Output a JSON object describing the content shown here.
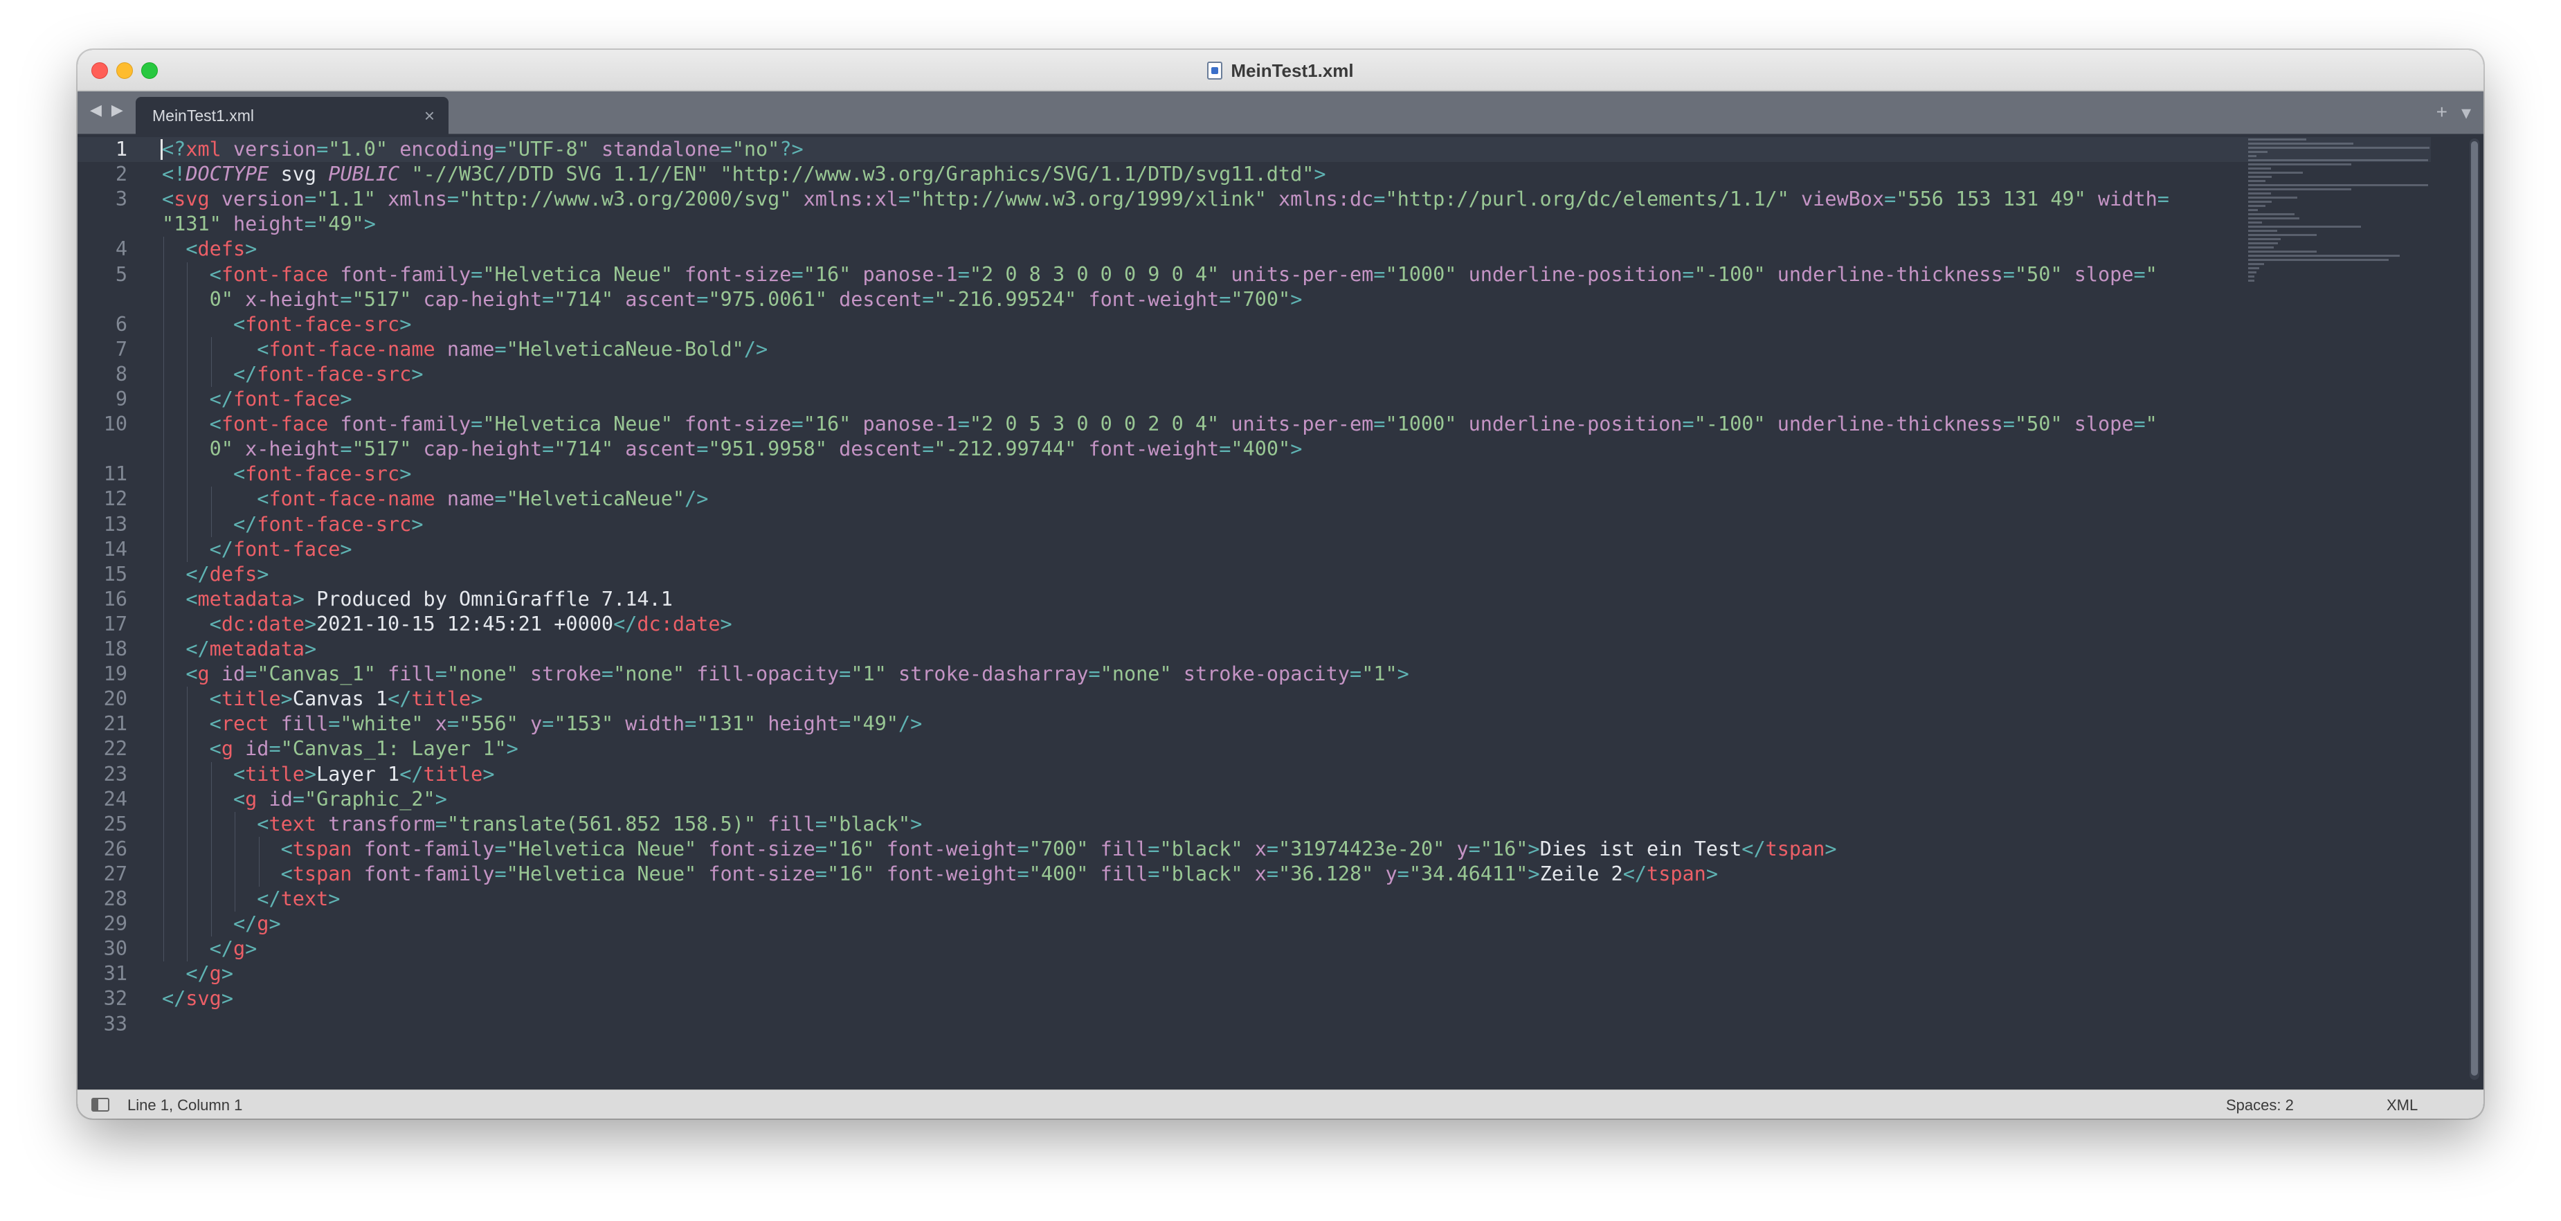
{
  "window": {
    "title": "MeinTest1.xml",
    "icon": "xml-file-icon"
  },
  "tabs": [
    {
      "label": "MeinTest1.xml",
      "close": "×"
    }
  ],
  "nav": {
    "back": "◀",
    "forward": "▶"
  },
  "tab_actions": {
    "new_tab": "+",
    "tab_menu": "▾"
  },
  "status": {
    "position": "Line 1, Column 1",
    "indent": "Spaces: 2",
    "syntax": "XML"
  },
  "editor": {
    "current_line": 1,
    "line_numbers": [
      "1",
      "2",
      "3",
      "4",
      "5",
      "6",
      "7",
      "8",
      "9",
      "10",
      "11",
      "12",
      "13",
      "14",
      "15",
      "16",
      "17",
      "18",
      "19",
      "20",
      "21",
      "22",
      "23",
      "24",
      "25",
      "26",
      "27",
      "28",
      "29",
      "30",
      "31",
      "32",
      "33"
    ]
  },
  "code_lines": [
    [
      [
        "p",
        "<?"
      ],
      [
        "tg",
        "xml"
      ],
      [
        "at",
        " version"
      ],
      [
        "p",
        "="
      ],
      [
        "st",
        "\"1.0\""
      ],
      [
        "at",
        " encoding"
      ],
      [
        "p",
        "="
      ],
      [
        "st",
        "\"UTF-8\""
      ],
      [
        "at",
        " standalone"
      ],
      [
        "p",
        "="
      ],
      [
        "st",
        "\"no\""
      ],
      [
        "p",
        "?>"
      ]
    ],
    [
      [
        "p",
        "<!"
      ],
      [
        "it",
        "DOCTYPE"
      ],
      [
        "tx",
        " svg "
      ],
      [
        "it",
        "PUBLIC"
      ],
      [
        "st",
        " \"-//W3C//DTD SVG 1.1//EN\""
      ],
      [
        "st",
        " \"http://www.w3.org/Graphics/SVG/1.1/DTD/svg11.dtd\""
      ],
      [
        "p",
        ">"
      ]
    ],
    [
      [
        "p",
        "<"
      ],
      [
        "tg",
        "svg"
      ],
      [
        "at",
        " version"
      ],
      [
        "p",
        "="
      ],
      [
        "st",
        "\"1.1\""
      ],
      [
        "at",
        " xmlns"
      ],
      [
        "p",
        "="
      ],
      [
        "st",
        "\"http://www.w3.org/2000/svg\""
      ],
      [
        "at",
        " xmlns:xl"
      ],
      [
        "p",
        "="
      ],
      [
        "st",
        "\"http://www.w3.org/1999/xlink\""
      ],
      [
        "at",
        " xmlns:dc"
      ],
      [
        "p",
        "="
      ],
      [
        "st",
        "\"http://purl.org/dc/elements/1.1/\""
      ],
      [
        "at",
        " viewBox"
      ],
      [
        "p",
        "="
      ],
      [
        "st",
        "\"556 153 131 49\""
      ],
      [
        "at",
        " width"
      ],
      [
        "p",
        "="
      ]
    ],
    [
      [
        "st",
        "\"131\""
      ],
      [
        "at",
        " height"
      ],
      [
        "p",
        "="
      ],
      [
        "st",
        "\"49\""
      ],
      [
        "p",
        ">"
      ]
    ],
    [
      [
        "tx",
        "  "
      ],
      [
        "p",
        "<"
      ],
      [
        "tg",
        "defs"
      ],
      [
        "p",
        ">"
      ]
    ],
    [
      [
        "tx",
        "    "
      ],
      [
        "p",
        "<"
      ],
      [
        "tg",
        "font-face"
      ],
      [
        "at",
        " font-family"
      ],
      [
        "p",
        "="
      ],
      [
        "st",
        "\"Helvetica Neue\""
      ],
      [
        "at",
        " font-size"
      ],
      [
        "p",
        "="
      ],
      [
        "st",
        "\"16\""
      ],
      [
        "at",
        " panose-1"
      ],
      [
        "p",
        "="
      ],
      [
        "st",
        "\"2 0 8 3 0 0 0 9 0 4\""
      ],
      [
        "at",
        " units-per-em"
      ],
      [
        "p",
        "="
      ],
      [
        "st",
        "\"1000\""
      ],
      [
        "at",
        " underline-position"
      ],
      [
        "p",
        "="
      ],
      [
        "st",
        "\"-100\""
      ],
      [
        "at",
        " underline-thickness"
      ],
      [
        "p",
        "="
      ],
      [
        "st",
        "\"50\""
      ],
      [
        "at",
        " slope"
      ],
      [
        "p",
        "="
      ],
      [
        "st",
        "\""
      ]
    ],
    [
      [
        "st",
        "    0\""
      ],
      [
        "at",
        " x-height"
      ],
      [
        "p",
        "="
      ],
      [
        "st",
        "\"517\""
      ],
      [
        "at",
        " cap-height"
      ],
      [
        "p",
        "="
      ],
      [
        "st",
        "\"714\""
      ],
      [
        "at",
        " ascent"
      ],
      [
        "p",
        "="
      ],
      [
        "st",
        "\"975.0061\""
      ],
      [
        "at",
        " descent"
      ],
      [
        "p",
        "="
      ],
      [
        "st",
        "\"-216.99524\""
      ],
      [
        "at",
        " font-weight"
      ],
      [
        "p",
        "="
      ],
      [
        "st",
        "\"700\""
      ],
      [
        "p",
        ">"
      ]
    ],
    [
      [
        "tx",
        "      "
      ],
      [
        "p",
        "<"
      ],
      [
        "tg",
        "font-face-src"
      ],
      [
        "p",
        ">"
      ]
    ],
    [
      [
        "tx",
        "        "
      ],
      [
        "p",
        "<"
      ],
      [
        "tg",
        "font-face-name"
      ],
      [
        "at",
        " name"
      ],
      [
        "p",
        "="
      ],
      [
        "st",
        "\"HelveticaNeue-Bold\""
      ],
      [
        "p",
        "/>"
      ]
    ],
    [
      [
        "tx",
        "      "
      ],
      [
        "p",
        "</"
      ],
      [
        "tg",
        "font-face-src"
      ],
      [
        "p",
        ">"
      ]
    ],
    [
      [
        "tx",
        "    "
      ],
      [
        "p",
        "</"
      ],
      [
        "tg",
        "font-face"
      ],
      [
        "p",
        ">"
      ]
    ],
    [
      [
        "tx",
        "    "
      ],
      [
        "p",
        "<"
      ],
      [
        "tg",
        "font-face"
      ],
      [
        "at",
        " font-family"
      ],
      [
        "p",
        "="
      ],
      [
        "st",
        "\"Helvetica Neue\""
      ],
      [
        "at",
        " font-size"
      ],
      [
        "p",
        "="
      ],
      [
        "st",
        "\"16\""
      ],
      [
        "at",
        " panose-1"
      ],
      [
        "p",
        "="
      ],
      [
        "st",
        "\"2 0 5 3 0 0 0 2 0 4\""
      ],
      [
        "at",
        " units-per-em"
      ],
      [
        "p",
        "="
      ],
      [
        "st",
        "\"1000\""
      ],
      [
        "at",
        " underline-position"
      ],
      [
        "p",
        "="
      ],
      [
        "st",
        "\"-100\""
      ],
      [
        "at",
        " underline-thickness"
      ],
      [
        "p",
        "="
      ],
      [
        "st",
        "\"50\""
      ],
      [
        "at",
        " slope"
      ],
      [
        "p",
        "="
      ],
      [
        "st",
        "\""
      ]
    ],
    [
      [
        "st",
        "    0\""
      ],
      [
        "at",
        " x-height"
      ],
      [
        "p",
        "="
      ],
      [
        "st",
        "\"517\""
      ],
      [
        "at",
        " cap-height"
      ],
      [
        "p",
        "="
      ],
      [
        "st",
        "\"714\""
      ],
      [
        "at",
        " ascent"
      ],
      [
        "p",
        "="
      ],
      [
        "st",
        "\"951.9958\""
      ],
      [
        "at",
        " descent"
      ],
      [
        "p",
        "="
      ],
      [
        "st",
        "\"-212.99744\""
      ],
      [
        "at",
        " font-weight"
      ],
      [
        "p",
        "="
      ],
      [
        "st",
        "\"400\""
      ],
      [
        "p",
        ">"
      ]
    ],
    [
      [
        "tx",
        "      "
      ],
      [
        "p",
        "<"
      ],
      [
        "tg",
        "font-face-src"
      ],
      [
        "p",
        ">"
      ]
    ],
    [
      [
        "tx",
        "        "
      ],
      [
        "p",
        "<"
      ],
      [
        "tg",
        "font-face-name"
      ],
      [
        "at",
        " name"
      ],
      [
        "p",
        "="
      ],
      [
        "st",
        "\"HelveticaNeue\""
      ],
      [
        "p",
        "/>"
      ]
    ],
    [
      [
        "tx",
        "      "
      ],
      [
        "p",
        "</"
      ],
      [
        "tg",
        "font-face-src"
      ],
      [
        "p",
        ">"
      ]
    ],
    [
      [
        "tx",
        "    "
      ],
      [
        "p",
        "</"
      ],
      [
        "tg",
        "font-face"
      ],
      [
        "p",
        ">"
      ]
    ],
    [
      [
        "tx",
        "  "
      ],
      [
        "p",
        "</"
      ],
      [
        "tg",
        "defs"
      ],
      [
        "p",
        ">"
      ]
    ],
    [
      [
        "tx",
        "  "
      ],
      [
        "p",
        "<"
      ],
      [
        "tg",
        "metadata"
      ],
      [
        "p",
        ">"
      ],
      [
        "tx",
        " Produced by OmniGraffle 7.14.1"
      ]
    ],
    [
      [
        "tx",
        "    "
      ],
      [
        "p",
        "<"
      ],
      [
        "tg",
        "dc:date"
      ],
      [
        "p",
        ">"
      ],
      [
        "tx",
        "2021-10-15 12:45:21 +0000"
      ],
      [
        "p",
        "</"
      ],
      [
        "tg",
        "dc:date"
      ],
      [
        "p",
        ">"
      ]
    ],
    [
      [
        "tx",
        "  "
      ],
      [
        "p",
        "</"
      ],
      [
        "tg",
        "metadata"
      ],
      [
        "p",
        ">"
      ]
    ],
    [
      [
        "tx",
        "  "
      ],
      [
        "p",
        "<"
      ],
      [
        "tg",
        "g"
      ],
      [
        "at",
        " id"
      ],
      [
        "p",
        "="
      ],
      [
        "st",
        "\"Canvas_1\""
      ],
      [
        "at",
        " fill"
      ],
      [
        "p",
        "="
      ],
      [
        "st",
        "\"none\""
      ],
      [
        "at",
        " stroke"
      ],
      [
        "p",
        "="
      ],
      [
        "st",
        "\"none\""
      ],
      [
        "at",
        " fill-opacity"
      ],
      [
        "p",
        "="
      ],
      [
        "st",
        "\"1\""
      ],
      [
        "at",
        " stroke-dasharray"
      ],
      [
        "p",
        "="
      ],
      [
        "st",
        "\"none\""
      ],
      [
        "at",
        " stroke-opacity"
      ],
      [
        "p",
        "="
      ],
      [
        "st",
        "\"1\""
      ],
      [
        "p",
        ">"
      ]
    ],
    [
      [
        "tx",
        "    "
      ],
      [
        "p",
        "<"
      ],
      [
        "tg",
        "title"
      ],
      [
        "p",
        ">"
      ],
      [
        "tx",
        "Canvas 1"
      ],
      [
        "p",
        "</"
      ],
      [
        "tg",
        "title"
      ],
      [
        "p",
        ">"
      ]
    ],
    [
      [
        "tx",
        "    "
      ],
      [
        "p",
        "<"
      ],
      [
        "tg",
        "rect"
      ],
      [
        "at",
        " fill"
      ],
      [
        "p",
        "="
      ],
      [
        "st",
        "\"white\""
      ],
      [
        "at",
        " x"
      ],
      [
        "p",
        "="
      ],
      [
        "st",
        "\"556\""
      ],
      [
        "at",
        " y"
      ],
      [
        "p",
        "="
      ],
      [
        "st",
        "\"153\""
      ],
      [
        "at",
        " width"
      ],
      [
        "p",
        "="
      ],
      [
        "st",
        "\"131\""
      ],
      [
        "at",
        " height"
      ],
      [
        "p",
        "="
      ],
      [
        "st",
        "\"49\""
      ],
      [
        "p",
        "/>"
      ]
    ],
    [
      [
        "tx",
        "    "
      ],
      [
        "p",
        "<"
      ],
      [
        "tg",
        "g"
      ],
      [
        "at",
        " id"
      ],
      [
        "p",
        "="
      ],
      [
        "st",
        "\"Canvas_1: Layer 1\""
      ],
      [
        "p",
        ">"
      ]
    ],
    [
      [
        "tx",
        "      "
      ],
      [
        "p",
        "<"
      ],
      [
        "tg",
        "title"
      ],
      [
        "p",
        ">"
      ],
      [
        "tx",
        "Layer 1"
      ],
      [
        "p",
        "</"
      ],
      [
        "tg",
        "title"
      ],
      [
        "p",
        ">"
      ]
    ],
    [
      [
        "tx",
        "      "
      ],
      [
        "p",
        "<"
      ],
      [
        "tg",
        "g"
      ],
      [
        "at",
        " id"
      ],
      [
        "p",
        "="
      ],
      [
        "st",
        "\"Graphic_2\""
      ],
      [
        "p",
        ">"
      ]
    ],
    [
      [
        "tx",
        "        "
      ],
      [
        "p",
        "<"
      ],
      [
        "tg",
        "text"
      ],
      [
        "at",
        " transform"
      ],
      [
        "p",
        "="
      ],
      [
        "st",
        "\"translate(561.852 158.5)\""
      ],
      [
        "at",
        " fill"
      ],
      [
        "p",
        "="
      ],
      [
        "st",
        "\"black\""
      ],
      [
        "p",
        ">"
      ]
    ],
    [
      [
        "tx",
        "          "
      ],
      [
        "p",
        "<"
      ],
      [
        "tg",
        "tspan"
      ],
      [
        "at",
        " font-family"
      ],
      [
        "p",
        "="
      ],
      [
        "st",
        "\"Helvetica Neue\""
      ],
      [
        "at",
        " font-size"
      ],
      [
        "p",
        "="
      ],
      [
        "st",
        "\"16\""
      ],
      [
        "at",
        " font-weight"
      ],
      [
        "p",
        "="
      ],
      [
        "st",
        "\"700\""
      ],
      [
        "at",
        " fill"
      ],
      [
        "p",
        "="
      ],
      [
        "st",
        "\"black\""
      ],
      [
        "at",
        " x"
      ],
      [
        "p",
        "="
      ],
      [
        "st",
        "\"31974423e-20\""
      ],
      [
        "at",
        " y"
      ],
      [
        "p",
        "="
      ],
      [
        "st",
        "\"16\""
      ],
      [
        "p",
        ">"
      ],
      [
        "tx",
        "Dies ist ein Test"
      ],
      [
        "p",
        "</"
      ],
      [
        "tg",
        "tspan"
      ],
      [
        "p",
        ">"
      ]
    ],
    [
      [
        "tx",
        "          "
      ],
      [
        "p",
        "<"
      ],
      [
        "tg",
        "tspan"
      ],
      [
        "at",
        " font-family"
      ],
      [
        "p",
        "="
      ],
      [
        "st",
        "\"Helvetica Neue\""
      ],
      [
        "at",
        " font-size"
      ],
      [
        "p",
        "="
      ],
      [
        "st",
        "\"16\""
      ],
      [
        "at",
        " font-weight"
      ],
      [
        "p",
        "="
      ],
      [
        "st",
        "\"400\""
      ],
      [
        "at",
        " fill"
      ],
      [
        "p",
        "="
      ],
      [
        "st",
        "\"black\""
      ],
      [
        "at",
        " x"
      ],
      [
        "p",
        "="
      ],
      [
        "st",
        "\"36.128\""
      ],
      [
        "at",
        " y"
      ],
      [
        "p",
        "="
      ],
      [
        "st",
        "\"34.46411\""
      ],
      [
        "p",
        ">"
      ],
      [
        "tx",
        "Zeile 2"
      ],
      [
        "p",
        "</"
      ],
      [
        "tg",
        "tspan"
      ],
      [
        "p",
        ">"
      ]
    ],
    [
      [
        "tx",
        "        "
      ],
      [
        "p",
        "</"
      ],
      [
        "tg",
        "text"
      ],
      [
        "p",
        ">"
      ]
    ],
    [
      [
        "tx",
        "      "
      ],
      [
        "p",
        "</"
      ],
      [
        "tg",
        "g"
      ],
      [
        "p",
        ">"
      ]
    ],
    [
      [
        "tx",
        "    "
      ],
      [
        "p",
        "</"
      ],
      [
        "tg",
        "g"
      ],
      [
        "p",
        ">"
      ]
    ],
    [
      [
        "tx",
        "  "
      ],
      [
        "p",
        "</"
      ],
      [
        "tg",
        "g"
      ],
      [
        "p",
        ">"
      ]
    ],
    [
      [
        "p",
        "</"
      ],
      [
        "tg",
        "svg"
      ],
      [
        "p",
        ">"
      ]
    ],
    []
  ]
}
